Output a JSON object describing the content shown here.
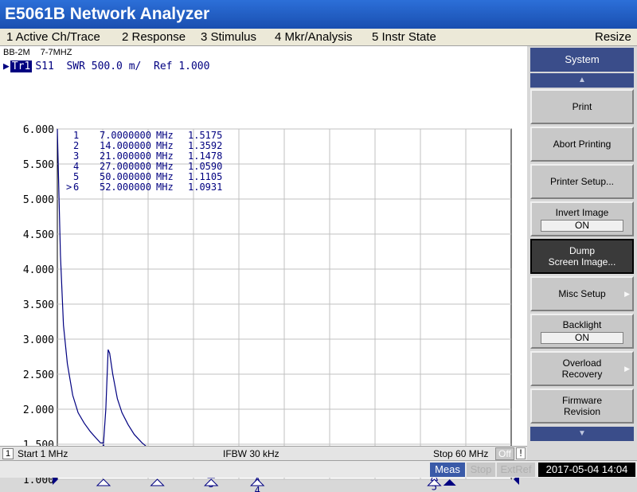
{
  "window": {
    "title": "E5061B Network Analyzer",
    "resize_label": "Resize"
  },
  "menu": [
    {
      "label": "1 Active Ch/Trace"
    },
    {
      "label": "2 Response"
    },
    {
      "label": "3 Stimulus"
    },
    {
      "label": "4 Mkr/Analysis"
    },
    {
      "label": "5 Instr State"
    }
  ],
  "channel": {
    "left_label": "BB-2M",
    "right_label": "7-7MHZ"
  },
  "trace": {
    "tag": "Tr1",
    "header": "S11  SWR 500.0 m/  Ref 1.000"
  },
  "chart_data": {
    "type": "line",
    "x_unit": "MHz",
    "xlim": [
      1,
      60
    ],
    "ylim": [
      1.0,
      6.0
    ],
    "ytick_labels": [
      "6.000",
      "5.500",
      "5.000",
      "4.500",
      "4.000",
      "3.500",
      "3.000",
      "2.500",
      "2.000",
      "1.500",
      "1.000"
    ],
    "ytick_values": [
      6.0,
      5.5,
      5.0,
      4.5,
      4.0,
      3.5,
      3.0,
      2.5,
      2.0,
      1.5,
      1.0
    ],
    "grid": true,
    "series": [
      {
        "color": "#000080",
        "x": [
          1.0,
          1.4,
          1.8,
          2.3,
          3.0,
          3.7,
          4.5,
          5.3,
          6.1,
          6.6,
          7.0,
          7.3,
          7.6,
          7.8,
          8.2,
          8.8,
          9.4,
          10.2,
          11.0,
          12.0,
          13.0,
          14.0,
          15.2,
          16.5,
          18.0,
          19.5,
          21.0,
          22.5,
          24.0,
          25.5,
          26.2,
          26.6,
          27.0,
          27.4,
          27.9,
          28.5,
          30.0,
          33.0,
          36.0,
          39.0,
          42.0,
          42.6,
          43.0,
          43.4,
          45.0,
          48.0,
          50.0,
          51.0,
          52.0,
          54.0,
          57.0,
          60.0
        ],
        "y": [
          6.0,
          4.2,
          3.2,
          2.65,
          2.2,
          1.95,
          1.8,
          1.68,
          1.58,
          1.52,
          1.5175,
          2.0,
          2.85,
          2.8,
          2.5,
          2.15,
          1.95,
          1.78,
          1.64,
          1.52,
          1.43,
          1.3592,
          1.27,
          1.21,
          1.18,
          1.16,
          1.1478,
          1.145,
          1.15,
          1.2,
          1.31,
          1.26,
          1.059,
          1.09,
          1.11,
          1.12,
          1.13,
          1.135,
          1.14,
          1.14,
          1.15,
          1.2,
          1.12,
          1.1,
          1.1,
          1.1,
          1.1105,
          1.12,
          1.0931,
          1.15,
          1.25,
          1.36
        ]
      }
    ],
    "markers": [
      {
        "num": "1",
        "freq": "7.0000000",
        "unit": "MHz",
        "value": "1.5175",
        "x": 7.0,
        "y": 1.5175
      },
      {
        "num": "2",
        "freq": "14.000000",
        "unit": "MHz",
        "value": "1.3592",
        "x": 14.0,
        "y": 1.3592
      },
      {
        "num": "3",
        "freq": "21.000000",
        "unit": "MHz",
        "value": "1.1478",
        "x": 21.0,
        "y": 1.1478
      },
      {
        "num": "4",
        "freq": "27.000000",
        "unit": "MHz",
        "value": "1.0590",
        "x": 27.0,
        "y": 1.059
      },
      {
        "num": "5",
        "freq": "50.000000",
        "unit": "MHz",
        "value": "1.1105",
        "x": 50.0,
        "y": 1.1105
      },
      {
        "num": "6",
        "freq": "52.000000",
        "unit": "MHz",
        "value": "1.0931",
        "x": 52.0,
        "y": 1.0931,
        "active": true
      }
    ],
    "marker_active_symbol": ">"
  },
  "status": {
    "channel": "1",
    "start": "Start 1 MHz",
    "ifbw": "IFBW 30 kHz",
    "stop": "Stop 60 MHz",
    "off_label": "Off",
    "excl": "!"
  },
  "indicators": {
    "meas": "Meas",
    "stop": "Stop",
    "extref": "ExtRef",
    "datetime": "2017-05-04 14:04"
  },
  "side": {
    "title": "System",
    "buttons": {
      "print": "Print",
      "abort": "Abort Printing",
      "printer_setup": "Printer Setup...",
      "invert_l1": "Invert Image",
      "invert_state": "ON",
      "dump_l1": "Dump",
      "dump_l2": "Screen Image...",
      "misc": "Misc Setup",
      "backlight_l1": "Backlight",
      "backlight_state": "ON",
      "overload_l1": "Overload",
      "overload_l2": "Recovery",
      "firmware_l1": "Firmware",
      "firmware_l2": "Revision"
    },
    "arrow_up": "▲",
    "arrow_down": "▼",
    "submenu_arrow": "▶"
  }
}
